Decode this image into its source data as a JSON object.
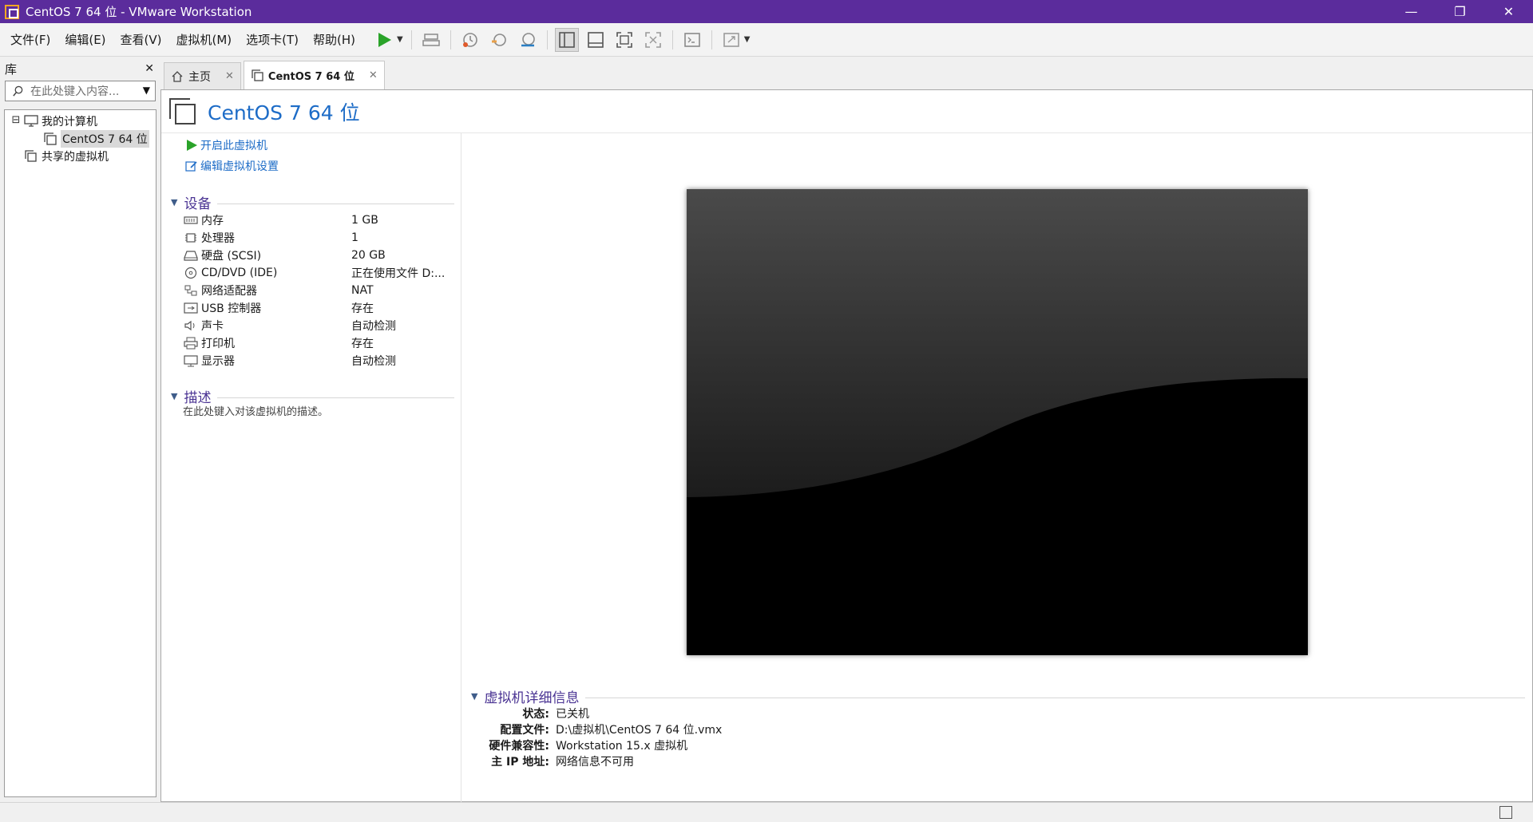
{
  "window": {
    "title": "CentOS 7 64 位 - VMware Workstation",
    "controls": {
      "minimize": "—",
      "restore": "❐",
      "close": "✕"
    }
  },
  "menu": [
    "文件(F)",
    "编辑(E)",
    "查看(V)",
    "虚拟机(M)",
    "选项卡(T)",
    "帮助(H)"
  ],
  "toolbar": {
    "power_icon": "play-icon",
    "accent": "#2aa329"
  },
  "library": {
    "title": "库",
    "close": "✕",
    "search_placeholder": "在此处键入内容...",
    "tree": {
      "my_computer": "我的计算机",
      "vm": "CentOS 7 64 位",
      "shared": "共享的虚拟机",
      "collapse": "⊟"
    }
  },
  "tabs": [
    {
      "label": "主页",
      "close": "✕"
    },
    {
      "label": "CentOS 7 64 位",
      "close": "✕"
    }
  ],
  "vm": {
    "title": "CentOS 7 64 位",
    "actions": {
      "power_on": "开启此虚拟机",
      "edit_settings": "编辑虚拟机设置"
    },
    "devices_header": "设备",
    "devices": [
      {
        "name": "内存",
        "value": "1 GB"
      },
      {
        "name": "处理器",
        "value": "1"
      },
      {
        "name": "硬盘 (SCSI)",
        "value": "20 GB"
      },
      {
        "name": "CD/DVD (IDE)",
        "value": "正在使用文件 D:..."
      },
      {
        "name": "网络适配器",
        "value": "NAT"
      },
      {
        "name": "USB 控制器",
        "value": "存在"
      },
      {
        "name": "声卡",
        "value": "自动检测"
      },
      {
        "name": "打印机",
        "value": "存在"
      },
      {
        "name": "显示器",
        "value": "自动检测"
      }
    ],
    "description_header": "描述",
    "description_placeholder": "在此处键入对该虚拟机的描述。",
    "details_header": "虚拟机详细信息",
    "details": [
      {
        "key": "状态:",
        "value": "已关机"
      },
      {
        "key": "配置文件:",
        "value": "D:\\虚拟机\\CentOS 7 64 位.vmx"
      },
      {
        "key": "硬件兼容性:",
        "value": "Workstation 15.x 虚拟机"
      },
      {
        "key": "主 IP 地址:",
        "value": "网络信息不可用"
      }
    ]
  }
}
